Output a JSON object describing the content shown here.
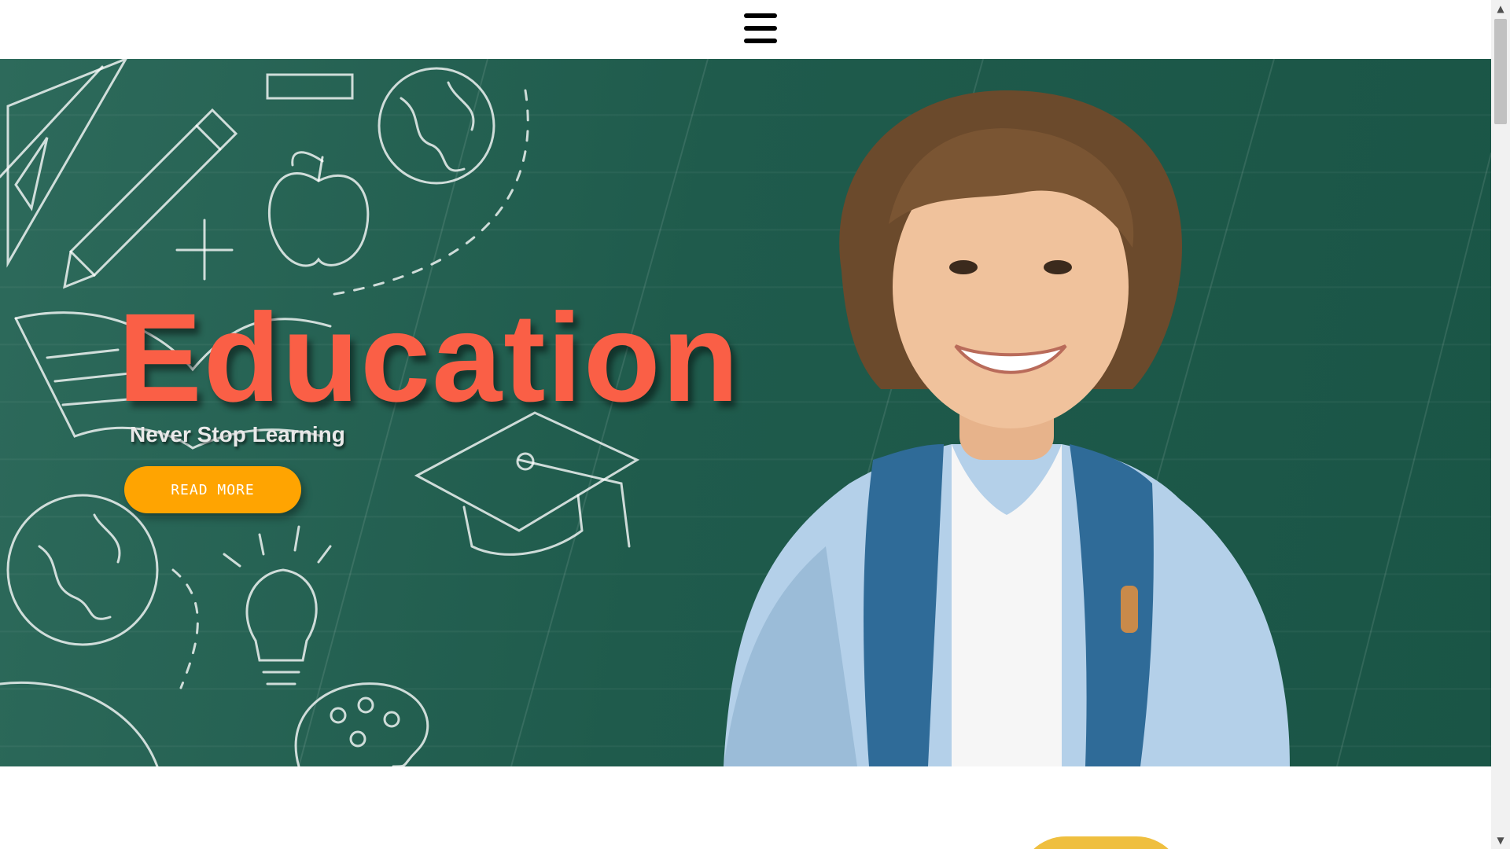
{
  "header": {
    "menu_icon": "hamburger-menu-icon"
  },
  "hero": {
    "title": "Education",
    "subtitle": "Never Stop Learning",
    "cta_label": "READ MORE",
    "image": "smiling-boy-with-backpack-in-front-of-chalkboard",
    "colors": {
      "chalkboard": "#1f5b4c",
      "title": "#fa5f46",
      "subtitle": "#e9e9e9",
      "cta": "#ffa401"
    }
  },
  "next_section": {
    "decor": "yellow-semicircle",
    "color": "#efbf3f"
  },
  "scrollbar": {
    "up_icon": "scroll-up-arrow-icon",
    "down_icon": "scroll-down-arrow-icon"
  }
}
